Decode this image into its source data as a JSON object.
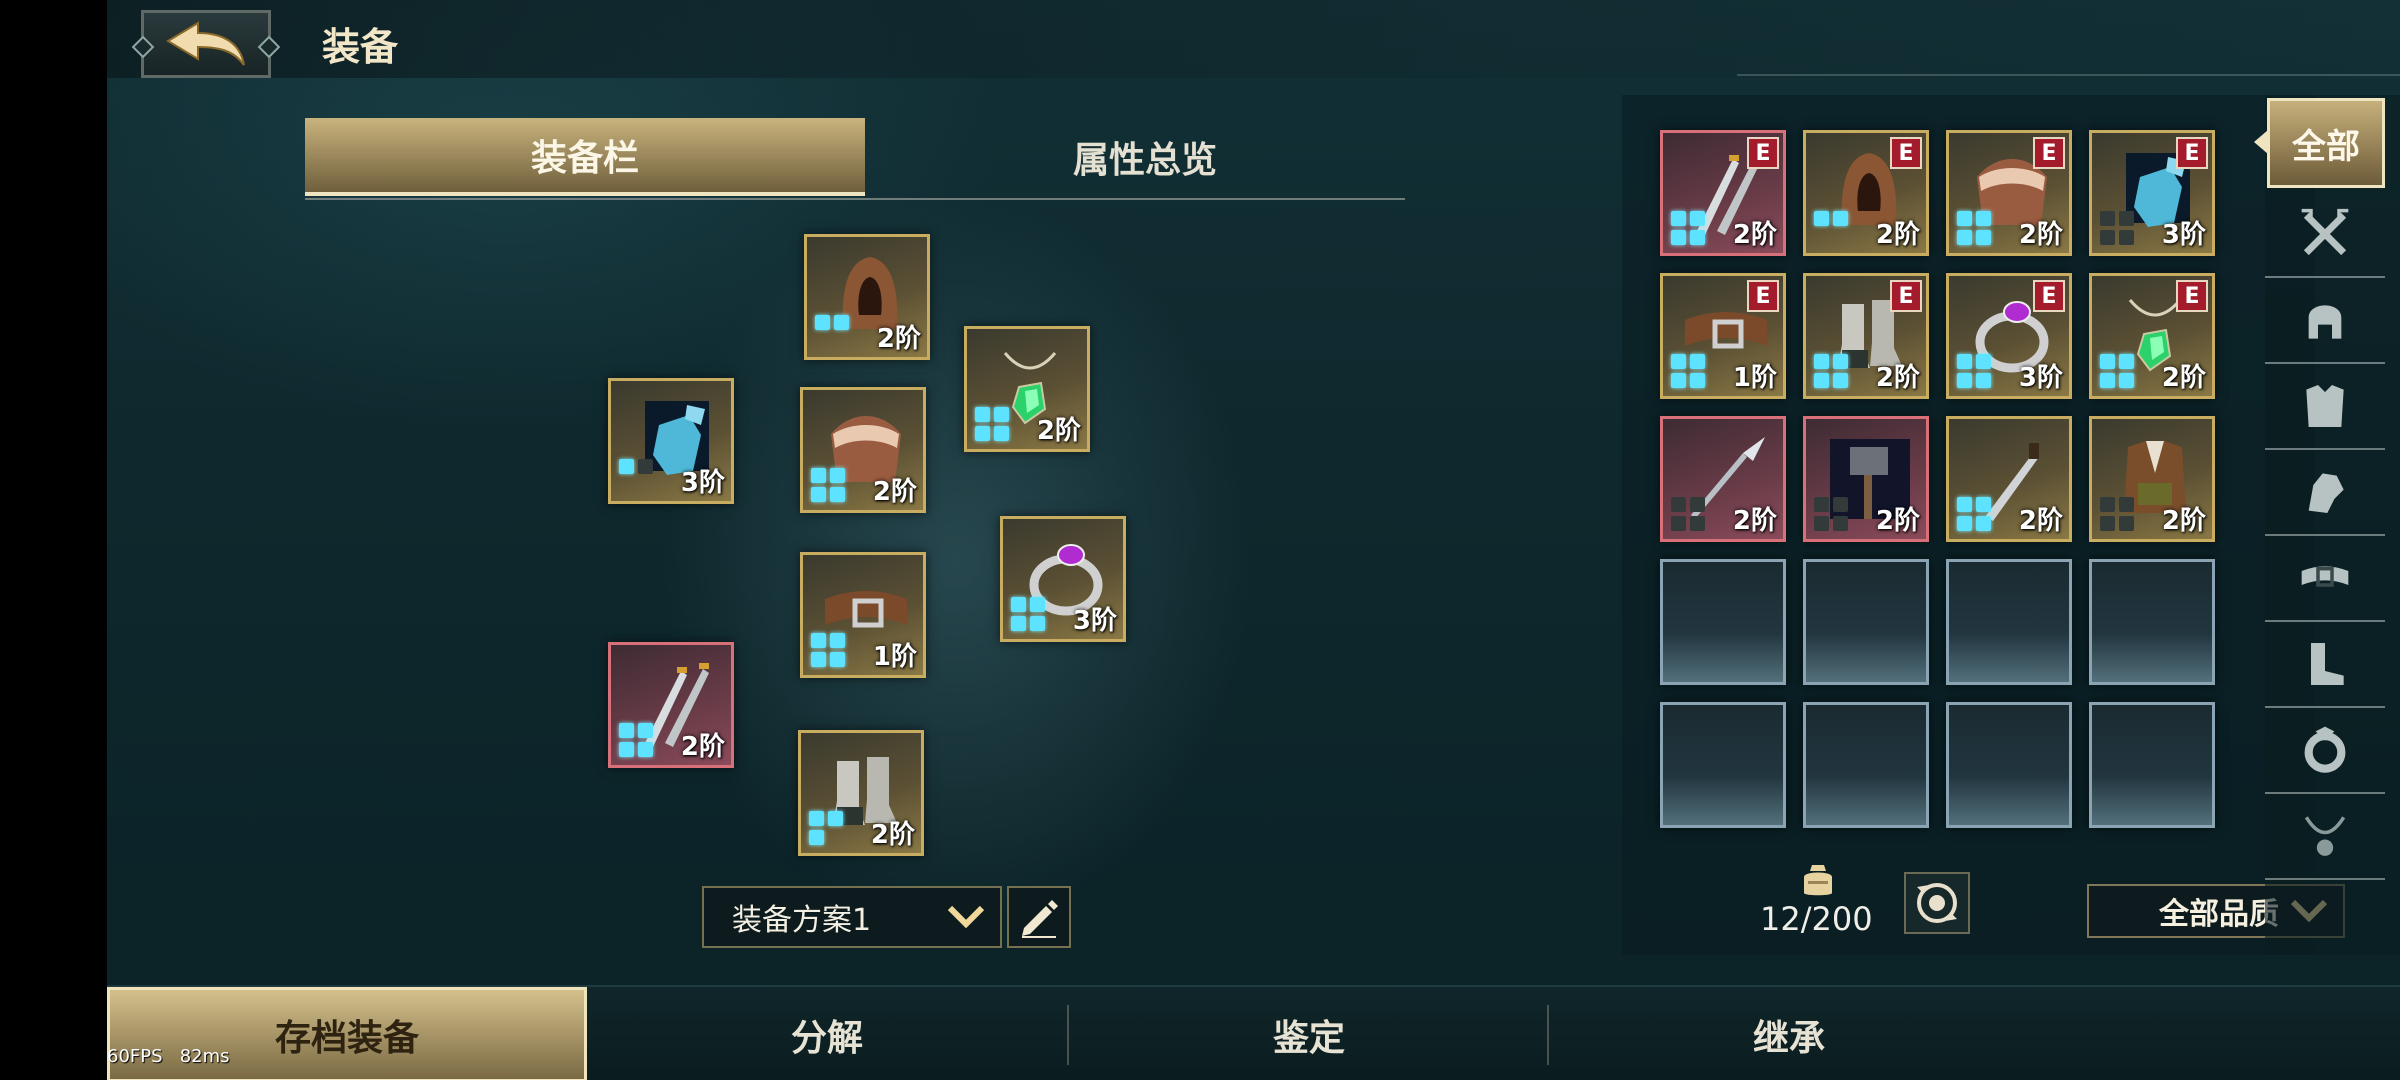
{
  "header": {
    "title": "装备"
  },
  "tabs": {
    "equip_slots": "装备栏",
    "attributes": "属性总览"
  },
  "colors": {
    "gold": "#c8ac5f",
    "red_quality": "#d87079",
    "gem_active": "#5de2ff",
    "badge": "#a41c2b"
  },
  "equipped": [
    {
      "name": "hood",
      "icon": "hood-icon",
      "tier": "2阶",
      "gems": [
        "on",
        "on"
      ]
    },
    {
      "name": "necklace",
      "icon": "green-amulet-icon",
      "tier": "2阶",
      "gems": [
        "on",
        "on",
        "on",
        "on"
      ]
    },
    {
      "name": "gloves",
      "icon": "blue-gloves-icon",
      "tier": "3阶",
      "gems": [
        "on",
        "off"
      ]
    },
    {
      "name": "cloak",
      "icon": "fur-mantle-icon",
      "tier": "2阶",
      "gems": [
        "on",
        "on",
        "on",
        "on"
      ]
    },
    {
      "name": "ring",
      "icon": "purple-ring-icon",
      "tier": "3阶",
      "gems": [
        "on",
        "on",
        "on",
        "on"
      ]
    },
    {
      "name": "belt",
      "icon": "belt-icon",
      "tier": "1阶",
      "gems": [
        "on",
        "on",
        "on",
        "on"
      ]
    },
    {
      "name": "weapon",
      "icon": "twin-daggers-icon",
      "tier": "2阶",
      "gems": [
        "on",
        "on",
        "on",
        "on"
      ]
    },
    {
      "name": "boots",
      "icon": "boots-icon",
      "tier": "2阶",
      "gems": [
        "on",
        "on",
        "on"
      ]
    }
  ],
  "loadout": {
    "label": "装备方案1"
  },
  "inventory": {
    "items": [
      {
        "icon": "twin-daggers-icon",
        "tier": "2阶",
        "badge": "E"
      },
      {
        "icon": "hood-icon",
        "tier": "2阶",
        "badge": "E"
      },
      {
        "icon": "fur-mantle-icon",
        "tier": "2阶",
        "badge": "E"
      },
      {
        "icon": "blue-gloves-icon",
        "tier": "3阶",
        "badge": "E"
      },
      {
        "icon": "belt-icon",
        "tier": "1阶",
        "badge": "E"
      },
      {
        "icon": "boots-icon",
        "tier": "2阶",
        "badge": "E"
      },
      {
        "icon": "purple-ring-icon",
        "tier": "3阶",
        "badge": "E"
      },
      {
        "icon": "green-amulet-icon",
        "tier": "2阶",
        "badge": "E"
      },
      {
        "icon": "spear-icon",
        "tier": "2阶"
      },
      {
        "icon": "hammer-icon",
        "tier": "2阶"
      },
      {
        "icon": "dagger-icon",
        "tier": "2阶"
      },
      {
        "icon": "leather-armor-icon",
        "tier": "2阶"
      }
    ],
    "count": "12/200",
    "quality_filter": "全部品质"
  },
  "categories": {
    "all": "全部",
    "icons": [
      "swords-icon",
      "helmet-icon",
      "chest-armor-icon",
      "glove-icon",
      "belt-icon",
      "boot-icon",
      "ring-icon",
      "necklace-icon"
    ]
  },
  "bottom_tabs": {
    "save": "存档装备",
    "dismantle": "分解",
    "identify": "鉴定",
    "inherit": "继承"
  },
  "debug": {
    "fps": "60FPS",
    "ms": "82ms"
  }
}
